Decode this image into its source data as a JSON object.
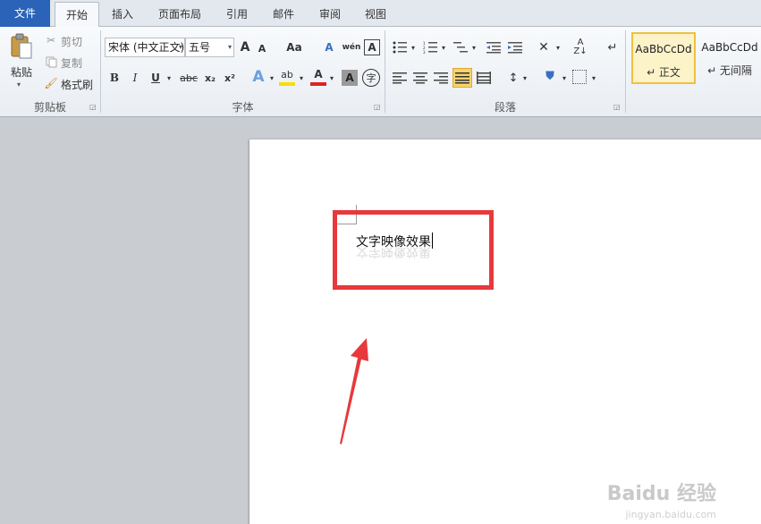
{
  "tabs": {
    "file": "文件",
    "items": [
      "开始",
      "插入",
      "页面布局",
      "引用",
      "邮件",
      "审阅",
      "视图"
    ]
  },
  "clipboard": {
    "paste": "粘贴",
    "cut": "剪切",
    "copy": "复制",
    "format_painter": "格式刷",
    "group_label": "剪贴板"
  },
  "font": {
    "font_name": "宋体 (中文正文)",
    "font_size": "五号",
    "grow": "A",
    "shrink": "A",
    "change_case": "Aa",
    "clear_format": "A",
    "phonetic": "wén",
    "border_char": "A",
    "bold": "B",
    "italic": "I",
    "underline": "U",
    "strike": "abc",
    "subscript": "x₂",
    "superscript": "x²",
    "text_effect": "A",
    "highlight": "ab",
    "font_color": "A",
    "char_shading": "A",
    "enclose": "字",
    "group_label": "字体"
  },
  "paragraph": {
    "group_label": "段落"
  },
  "styles": {
    "items": [
      {
        "sample": "AaBbCcDd",
        "name": "↵ 正文"
      },
      {
        "sample": "AaBbCcDd",
        "name": "↵ 无间隔"
      }
    ]
  },
  "document": {
    "text": "文字映像效果"
  },
  "watermark": {
    "brand": "Baidu 经验",
    "url": "jingyan.baidu.com"
  },
  "colors": {
    "file_tab": "#2a63b8",
    "annotation_red": "#e7393b",
    "font_color_bar": "#e02020",
    "highlight_bar": "#f5e000",
    "selected_style": "#fdf3c9"
  }
}
